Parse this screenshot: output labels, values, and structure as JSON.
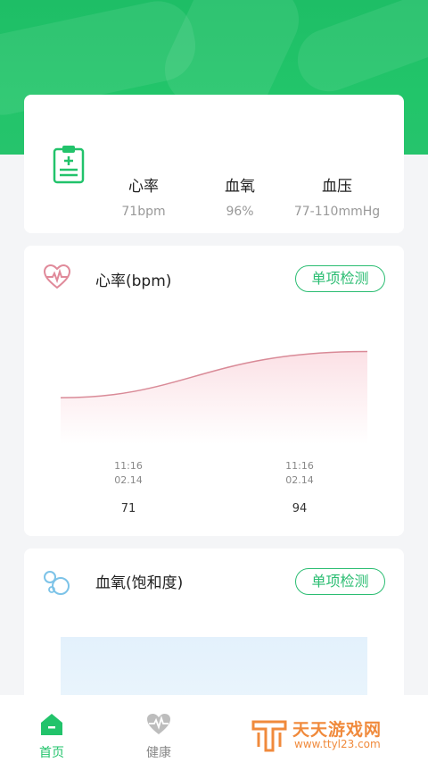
{
  "summary": {
    "metrics": [
      {
        "name": "心率",
        "value": "71bpm"
      },
      {
        "name": "血氧",
        "value": "96%"
      },
      {
        "name": "血压",
        "value": "77-110mmHg"
      }
    ]
  },
  "heart_rate": {
    "title": "心率(bpm)",
    "button_label": "单项检测",
    "chart_data": {
      "type": "area",
      "x": [
        "11:16 02.14",
        "11:16 02.14"
      ],
      "values": [
        71,
        94
      ],
      "ylim": [
        0,
        120
      ]
    },
    "ticks": [
      {
        "time": "11:16",
        "date": "02.14",
        "value": "71"
      },
      {
        "time": "11:16",
        "date": "02.14",
        "value": "94"
      }
    ],
    "colors": {
      "line": "#d98a97",
      "fill": "#fbe3e7"
    }
  },
  "oxygen": {
    "title": "血氧(饱和度)",
    "button_label": "单项检测",
    "colors": {
      "fill": "#e3f1fc"
    }
  },
  "nav": {
    "items": [
      {
        "label": "首页",
        "icon": "home-icon",
        "active": true
      },
      {
        "label": "健康",
        "icon": "heart-pulse-icon",
        "active": false
      }
    ],
    "active_color": "#22c36b",
    "inactive_color": "#888888"
  },
  "watermark": {
    "name": "天天游戏网",
    "url": "www.ttyl23.com"
  }
}
